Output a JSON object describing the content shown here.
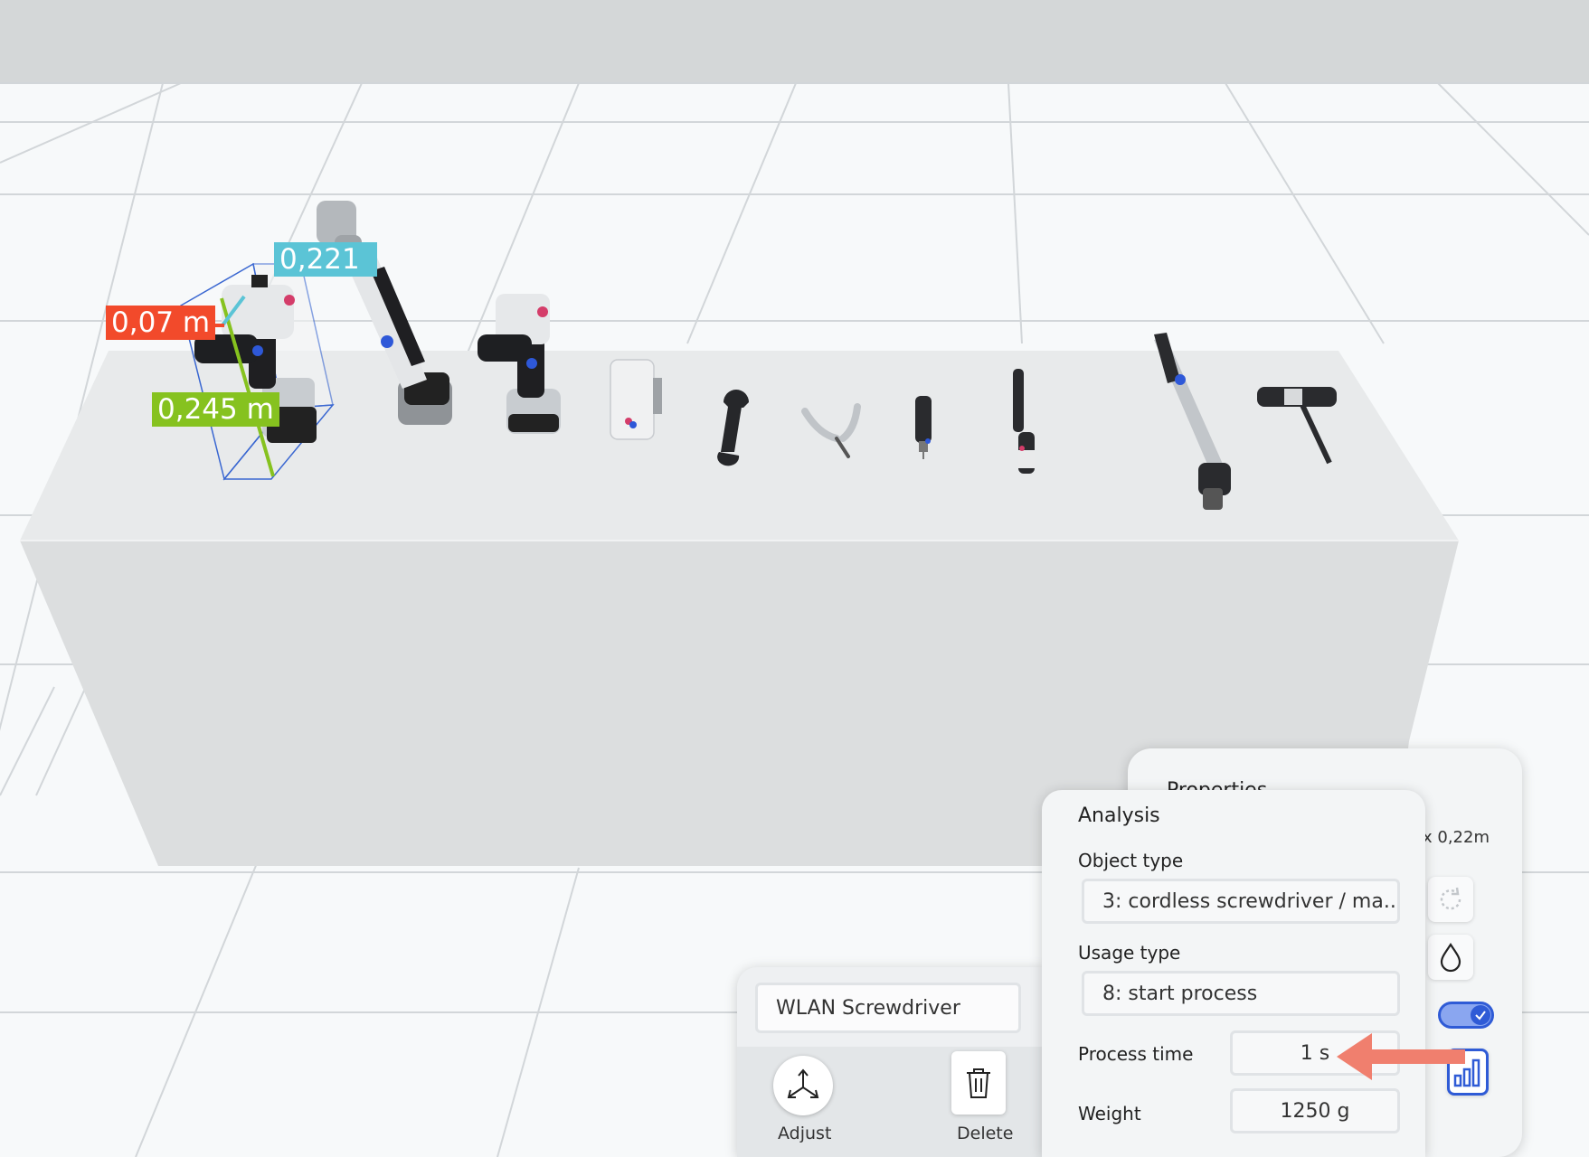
{
  "measurements": {
    "depth": "0,07 m",
    "width": "0,221",
    "height": "0,245 m"
  },
  "properties_panel": {
    "title": "Properties",
    "dimension_readout": "x 0,22m"
  },
  "analysis_panel": {
    "title": "Analysis",
    "object_type_label": "Object type",
    "object_type_value": "3: cordless screwdriver / ma...",
    "usage_type_label": "Usage type",
    "usage_type_value": "8: start process",
    "process_time_label": "Process time",
    "process_time_value": "1 s",
    "weight_label": "Weight",
    "weight_value": "1250 g"
  },
  "object_panel": {
    "name_value": "WLAN Screwdriver",
    "adjust_label": "Adjust",
    "delete_label": "Delete"
  },
  "icons": {
    "adjust": "axes-icon",
    "delete": "trash-icon",
    "rotate": "rotate-icon",
    "material": "drop-icon",
    "toggle": "check-toggle",
    "analysis": "bar-chart-icon",
    "annotation": "arrow-icon"
  },
  "colors": {
    "depth": "#f24a2b",
    "width": "#5bc4d6",
    "height": "#86c21f",
    "accent": "#2f5bd6",
    "annotation": "#f07f6e"
  }
}
